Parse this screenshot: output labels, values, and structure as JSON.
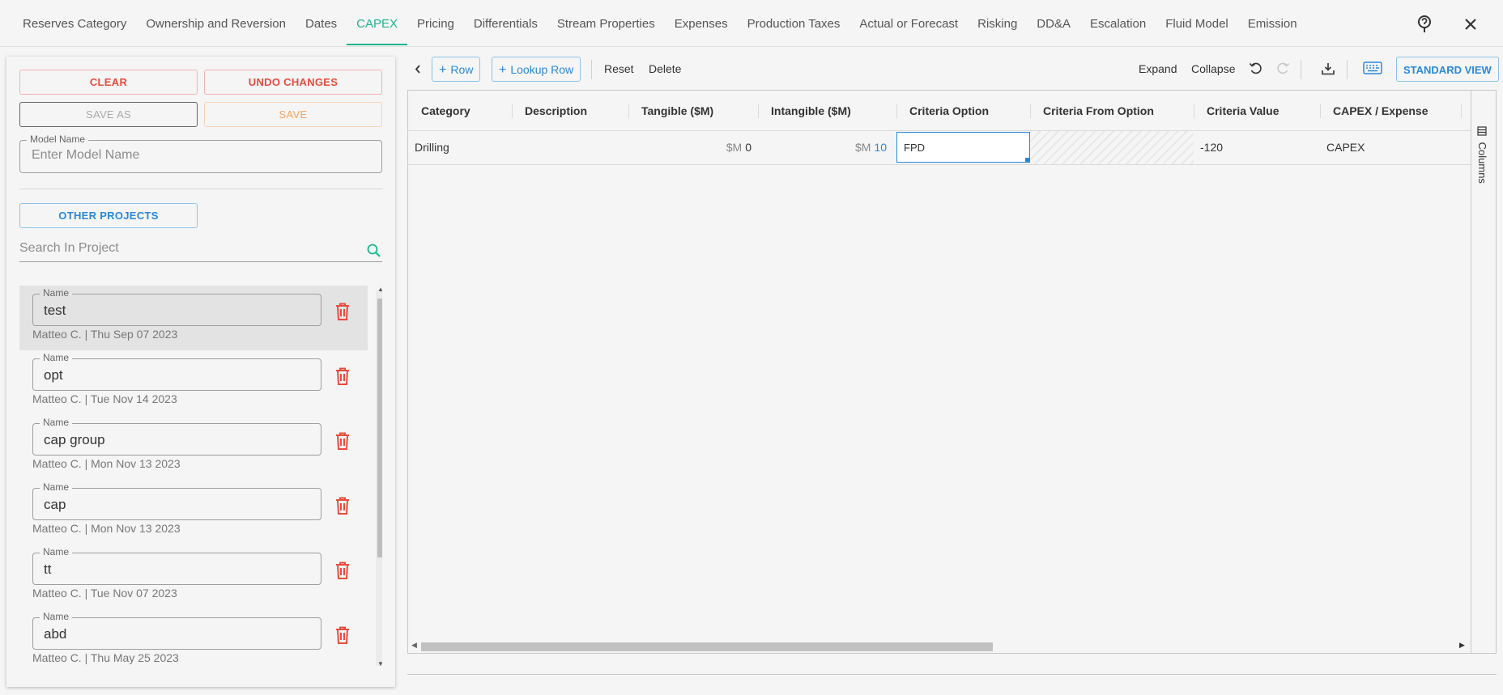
{
  "tabs": [
    {
      "label": "Reserves Category"
    },
    {
      "label": "Ownership and Reversion"
    },
    {
      "label": "Dates"
    },
    {
      "label": "CAPEX",
      "active": true
    },
    {
      "label": "Pricing"
    },
    {
      "label": "Differentials"
    },
    {
      "label": "Stream Properties"
    },
    {
      "label": "Expenses"
    },
    {
      "label": "Production Taxes"
    },
    {
      "label": "Actual or Forecast"
    },
    {
      "label": "Risking"
    },
    {
      "label": "DD&A"
    },
    {
      "label": "Escalation"
    },
    {
      "label": "Fluid Model"
    },
    {
      "label": "Emission"
    }
  ],
  "top_icons": {
    "help": "help-icon",
    "close": "close-icon"
  },
  "left_panel": {
    "clear_label": "CLEAR",
    "undo_label": "UNDO CHANGES",
    "save_as_label": "SAVE AS",
    "save_label": "SAVE",
    "model_name_label": "Model Name",
    "model_name_placeholder": "Enter Model Name",
    "other_projects_label": "OTHER PROJECTS",
    "search_placeholder": "Search In Project",
    "name_label": "Name",
    "models": [
      {
        "name": "test",
        "meta": "Matteo C. | Thu Sep 07 2023",
        "selected": true
      },
      {
        "name": "opt",
        "meta": "Matteo C. | Tue Nov 14 2023"
      },
      {
        "name": "cap group",
        "meta": "Matteo C. | Mon Nov 13 2023"
      },
      {
        "name": "cap",
        "meta": "Matteo C. | Mon Nov 13 2023"
      },
      {
        "name": "tt",
        "meta": "Matteo C. | Tue Nov 07 2023"
      },
      {
        "name": "abd",
        "meta": "Matteo C. | Thu May 25 2023"
      }
    ]
  },
  "toolbar": {
    "add_row_label": "Row",
    "lookup_row_label": "Lookup Row",
    "reset_label": "Reset",
    "delete_label": "Delete",
    "expand_label": "Expand",
    "collapse_label": "Collapse",
    "standard_view_label": "STANDARD VIEW"
  },
  "grid": {
    "columns": [
      "Category",
      "Description",
      "Tangible ($M)",
      "Intangible ($M)",
      "Criteria Option",
      "Criteria From Option",
      "Criteria Value",
      "CAPEX / Expense"
    ],
    "rows": [
      {
        "category": "Drilling",
        "description": "",
        "tangible_unit": "$M",
        "tangible": "0",
        "intangible_unit": "$M",
        "intangible": "10",
        "criteria_option": "FPD",
        "criteria_from_option": "",
        "criteria_value": "-120",
        "capex_expense": "CAPEX"
      }
    ],
    "side_panel_label": "Columns"
  },
  "colors": {
    "accent": "#1db58f",
    "danger": "#e84c3d",
    "primary": "#2b88d8",
    "warning": "#f0a560"
  }
}
